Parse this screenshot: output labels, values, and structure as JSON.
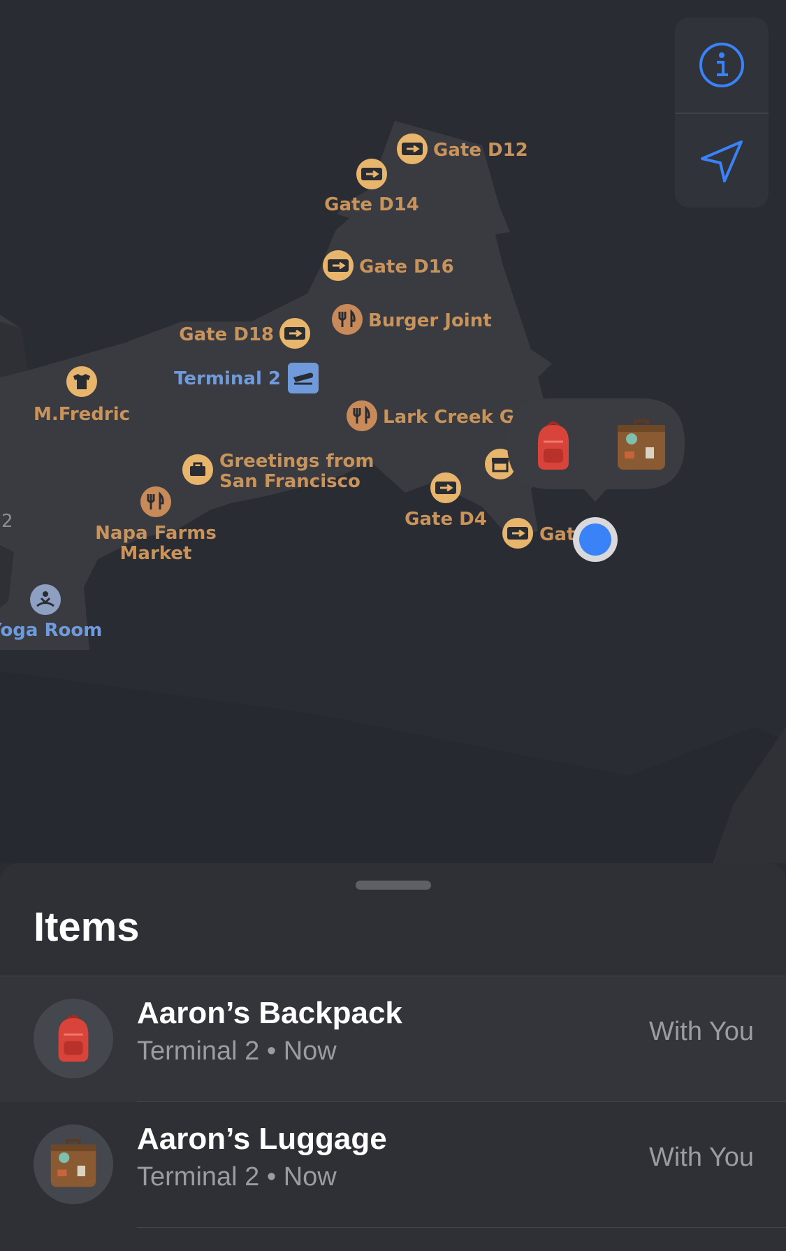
{
  "map": {
    "labels": {
      "gate_d12": "Gate D12",
      "gate_d14": "Gate D14",
      "gate_d16": "Gate D16",
      "gate_d18": "Gate D18",
      "burger_joint": "Burger Joint",
      "terminal_2": "Terminal 2",
      "m_fredric": "M.Fredric",
      "lark_creek": "Lark Creek Gri",
      "greetings_1": "Greetings from",
      "greetings_2": "San Francisco",
      "napa_1": "Napa Farms",
      "napa_2": "Market",
      "gate_d4": "Gate D4",
      "gate_partial": "Gat",
      "yoga_room": "Yoga Room",
      "edge_2": "2"
    },
    "icons": {
      "gate": "boarding-pass-icon",
      "food": "fork-knife-icon",
      "shop": "tshirt-icon",
      "gift": "shopping-bag-icon",
      "store": "storefront-icon",
      "terminal": "airplane-departure-icon",
      "yoga": "meditation-icon"
    },
    "cluster_items": [
      "backpack-emoji",
      "luggage-emoji"
    ],
    "colors": {
      "poi": "#c9935c",
      "poi_icon_bg": "#e8b56c",
      "terminal": "#6f9bdc",
      "user_location": "#3a82f7"
    }
  },
  "controls": {
    "info_icon": "info-icon",
    "location_icon": "location-arrow-icon",
    "accent": "#3a82f7"
  },
  "sheet": {
    "title": "Items",
    "items": [
      {
        "icon": "backpack-icon",
        "name": "Aaron’s Backpack",
        "subtitle": "Terminal 2 • Now",
        "status": "With You"
      },
      {
        "icon": "luggage-icon",
        "name": "Aaron’s Luggage",
        "subtitle": "Terminal 2 • Now",
        "status": "With You"
      }
    ]
  }
}
